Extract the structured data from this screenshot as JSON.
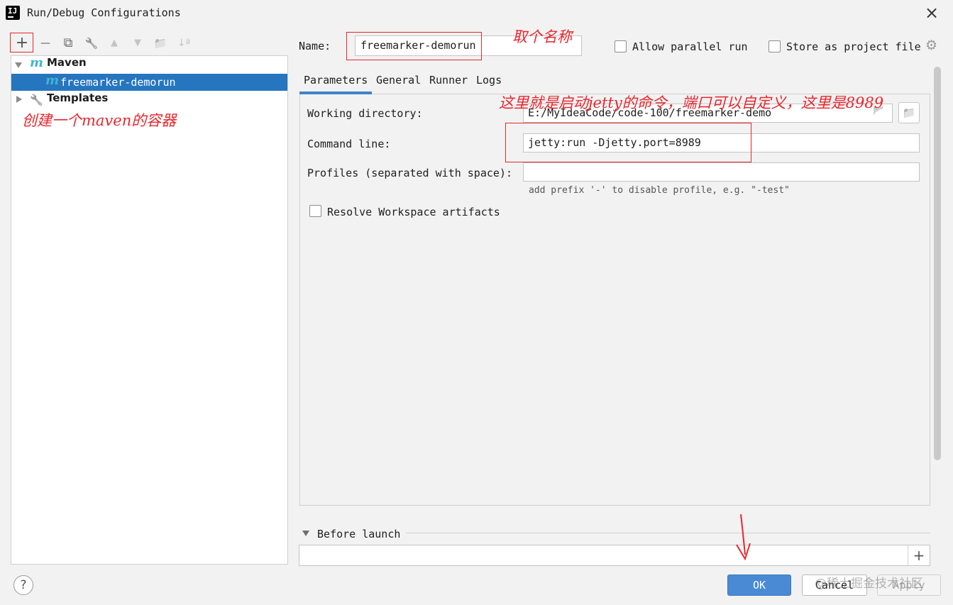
{
  "window": {
    "title": "Run/Debug Configurations",
    "close": "×",
    "app_icon_text": "IJ"
  },
  "toolbar": {
    "add": "+",
    "remove": "—",
    "copy": "⧉",
    "edit": "🔧",
    "up": "▲",
    "down": "▼",
    "folder": "📁",
    "sort": "↓ª"
  },
  "tree": {
    "maven": {
      "icon": "m",
      "label": "Maven"
    },
    "config": {
      "icon": "m",
      "label": "freemarker-demorun"
    },
    "templates": {
      "label": "Templates"
    }
  },
  "annotations": {
    "name_note": "取个名称",
    "command_note": "这里就是启动jetty的命令，端口可以自定义，这里是8989",
    "maven_note": "创建一个maven的容器"
  },
  "form": {
    "name_label": "Name:",
    "name_value": "freemarker-demorun",
    "allow_parallel": "Allow parallel run",
    "store_as_project": "Store as project file",
    "tabs": [
      "Parameters",
      "General",
      "Runner",
      "Logs"
    ],
    "working_dir_label": "Working directory:",
    "working_dir_value": "E:/MyIdeaCode/code-100/freemarker-demo",
    "command_line_label": "Command line:",
    "command_line_value": "jetty:run -Djetty.port=8989",
    "profiles_label": "Profiles (separated with space):",
    "profiles_value": "",
    "profiles_hint": "add prefix '-' to disable profile, e.g. \"-test\"",
    "resolve_workspace": "Resolve Workspace artifacts",
    "before_launch": "Before launch",
    "before_launch_add": "+"
  },
  "buttons": {
    "help": "?",
    "ok": "OK",
    "cancel": "Cancel",
    "apply": "Apply"
  },
  "watermark": "@稀土掘金技术社区",
  "colors": {
    "accent": "#2675bf",
    "annotation": "#e8262d",
    "ok_button": "#4a8ad4"
  }
}
